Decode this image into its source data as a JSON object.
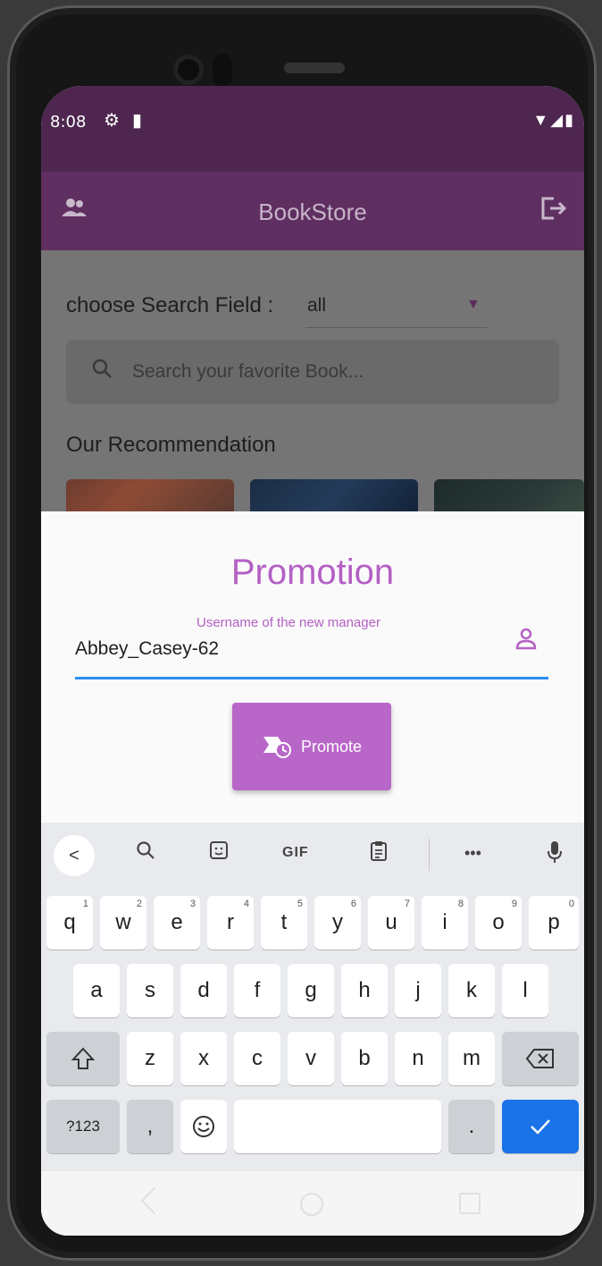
{
  "status_bar": {
    "time": "8:08",
    "left_icons": [
      "gear-icon",
      "sd-card-icon"
    ],
    "right_icons": [
      "wifi-icon",
      "signal-icon",
      "battery-icon"
    ]
  },
  "app_bar": {
    "title": "BookStore",
    "left_icon": "people-icon",
    "right_icon": "logout-icon",
    "color": "#5f2f61"
  },
  "search": {
    "field_label": "choose Search Field :",
    "field_value": "all",
    "placeholder": "Search your favorite Book..."
  },
  "recommendation": {
    "title": "Our Recommendation"
  },
  "promotion_sheet": {
    "title": "Promotion",
    "input_label": "Username of the new manager",
    "input_value": "Abbey_Casey-62",
    "button_label": "Promote",
    "accent_color": "#b866c8"
  },
  "keyboard": {
    "toolbar": [
      "back-icon",
      "search-icon",
      "sticker-icon",
      "GIF",
      "clipboard-icon",
      "more-icon",
      "mic-icon"
    ],
    "gif_label": "GIF",
    "more_label": "•••",
    "row1": [
      "q",
      "w",
      "e",
      "r",
      "t",
      "y",
      "u",
      "i",
      "o",
      "p"
    ],
    "row1_numbers": [
      "1",
      "2",
      "3",
      "4",
      "5",
      "6",
      "7",
      "8",
      "9",
      "0"
    ],
    "row2": [
      "a",
      "s",
      "d",
      "f",
      "g",
      "h",
      "j",
      "k",
      "l"
    ],
    "row3": [
      "z",
      "x",
      "c",
      "v",
      "b",
      "n",
      "m"
    ],
    "symbols_label": "?123",
    "comma_label": ",",
    "period_label": "."
  }
}
